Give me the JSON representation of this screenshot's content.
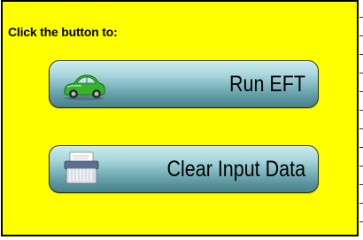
{
  "panel": {
    "background": "#ffff00",
    "prompt": "Click the button to:"
  },
  "buttons": {
    "run": {
      "label": "Run EFT",
      "icon": "car-icon"
    },
    "clear": {
      "label": "Clear Input Data",
      "icon": "shredder-icon"
    }
  }
}
